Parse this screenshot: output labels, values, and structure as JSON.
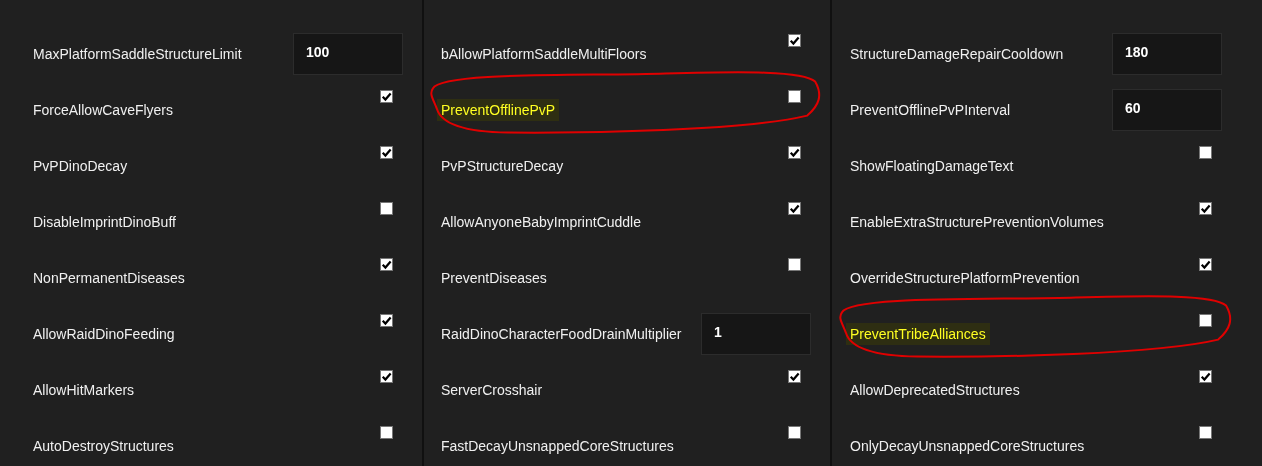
{
  "columns": [
    {
      "settings": [
        {
          "kind": "number",
          "label": "MaxPlatformSaddleStructureLimit",
          "value": "100",
          "highlighted": false
        },
        {
          "kind": "checkbox",
          "label": "ForceAllowCaveFlyers",
          "checked": true,
          "highlighted": false
        },
        {
          "kind": "checkbox",
          "label": "PvPDinoDecay",
          "checked": true,
          "highlighted": false
        },
        {
          "kind": "checkbox",
          "label": "DisableImprintDinoBuff",
          "checked": false,
          "highlighted": false
        },
        {
          "kind": "checkbox",
          "label": "NonPermanentDiseases",
          "checked": true,
          "highlighted": false
        },
        {
          "kind": "checkbox",
          "label": "AllowRaidDinoFeeding",
          "checked": true,
          "highlighted": false
        },
        {
          "kind": "checkbox",
          "label": "AllowHitMarkers",
          "checked": true,
          "highlighted": false
        },
        {
          "kind": "checkbox",
          "label": "AutoDestroyStructures",
          "checked": false,
          "highlighted": false
        }
      ]
    },
    {
      "settings": [
        {
          "kind": "checkbox",
          "label": "bAllowPlatformSaddleMultiFloors",
          "checked": true,
          "highlighted": false
        },
        {
          "kind": "checkbox",
          "label": "PreventOfflinePvP",
          "checked": false,
          "highlighted": true
        },
        {
          "kind": "checkbox",
          "label": "PvPStructureDecay",
          "checked": true,
          "highlighted": false
        },
        {
          "kind": "checkbox",
          "label": "AllowAnyoneBabyImprintCuddle",
          "checked": true,
          "highlighted": false
        },
        {
          "kind": "checkbox",
          "label": "PreventDiseases",
          "checked": false,
          "highlighted": false
        },
        {
          "kind": "number",
          "label": "RaidDinoCharacterFoodDrainMultiplier",
          "value": "1",
          "highlighted": false
        },
        {
          "kind": "checkbox",
          "label": "ServerCrosshair",
          "checked": true,
          "highlighted": false
        },
        {
          "kind": "checkbox",
          "label": "FastDecayUnsnappedCoreStructures",
          "checked": false,
          "highlighted": false
        }
      ]
    },
    {
      "settings": [
        {
          "kind": "number",
          "label": "StructureDamageRepairCooldown",
          "value": "180",
          "highlighted": false
        },
        {
          "kind": "number",
          "label": "PreventOfflinePvPInterval",
          "value": "60",
          "highlighted": false
        },
        {
          "kind": "checkbox",
          "label": "ShowFloatingDamageText",
          "checked": false,
          "highlighted": false
        },
        {
          "kind": "checkbox",
          "label": "EnableExtraStructurePreventionVolumes",
          "checked": true,
          "highlighted": false
        },
        {
          "kind": "checkbox",
          "label": "OverrideStructurePlatformPrevention",
          "checked": true,
          "highlighted": false
        },
        {
          "kind": "checkbox",
          "label": "PreventTribeAlliances",
          "checked": false,
          "highlighted": true
        },
        {
          "kind": "checkbox",
          "label": "AllowDeprecatedStructures",
          "checked": true,
          "highlighted": false
        },
        {
          "kind": "checkbox",
          "label": "OnlyDecayUnsnappedCoreStructures",
          "checked": false,
          "highlighted": false
        }
      ]
    }
  ]
}
